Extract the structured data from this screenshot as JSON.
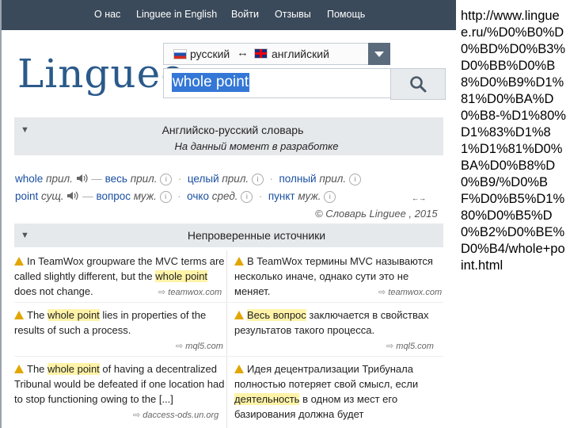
{
  "nav": {
    "about": "О нас",
    "english": "Linguee in English",
    "login": "Войти",
    "reviews": "Отзывы",
    "help": "Помощь"
  },
  "logo": "Linguee",
  "lang": {
    "source": "русский",
    "swap": "↔",
    "target": "английский"
  },
  "search": {
    "value": "whole point"
  },
  "dictionary": {
    "title": "Английско-русский словарь",
    "subtitle": "На данный момент в разработке",
    "rows": [
      {
        "word": "whole",
        "pos": "прил.",
        "t1": "весь",
        "t1pos": "прил.",
        "t2": "целый",
        "t2pos": "прил.",
        "t3": "полный",
        "t3pos": "прил."
      },
      {
        "word": "point",
        "pos": "сущ.",
        "t1": "вопрос",
        "t1pos": "муж.",
        "t2": "очко",
        "t2pos": "сред.",
        "t3": "пункт",
        "t3pos": "муж."
      }
    ],
    "more_arrow": "←→",
    "copyright": "© Словарь Linguee , 2015"
  },
  "unverified": {
    "title": "Непроверенные источники"
  },
  "examples": [
    {
      "en": [
        "In TeamWox groupware the MVC terms are",
        "called slightly different, but the ",
        "whole point",
        "does not change."
      ],
      "en_src": "teamwox.com",
      "ru": [
        "В TeamWox термины MVC называются",
        "несколько иначе, однако сути это не",
        "меняет."
      ],
      "ru_src": "teamwox.com"
    },
    {
      "en": [
        "The ",
        "whole point",
        " lies in properties of the",
        "results of such a process."
      ],
      "en_src": "mql5.com",
      "ru": [
        "Весь вопрос",
        " заключается в свойствах",
        "результатов такого процесса."
      ],
      "ru_src": "mql5.com"
    },
    {
      "en": [
        "The ",
        "whole point",
        " of having a decentralized",
        "Tribunal would be defeated if one location had",
        "to stop functioning owing to the [...]"
      ],
      "en_src": "daccess-ods.un.org",
      "ru": [
        "Идея децентрализации Трибунала",
        "полностью потеряет свой смысл, если",
        "деятельность",
        " в одном из мест его",
        "базирования должна будет"
      ]
    }
  ],
  "side_url": "http://www.linguee.ru/%D0%B0%D0%BD%D0%B3%D0%BB%D0%B8%D0%B9%D1%81%D0%BA%D0%B8-%D1%80%D1%83%D1%81%D1%81%D0%BA%D0%B8%D0%B9/%D0%BF%D0%B5%D1%80%D0%B5%D0%B2%D0%BE%D0%B4/whole+point.html"
}
